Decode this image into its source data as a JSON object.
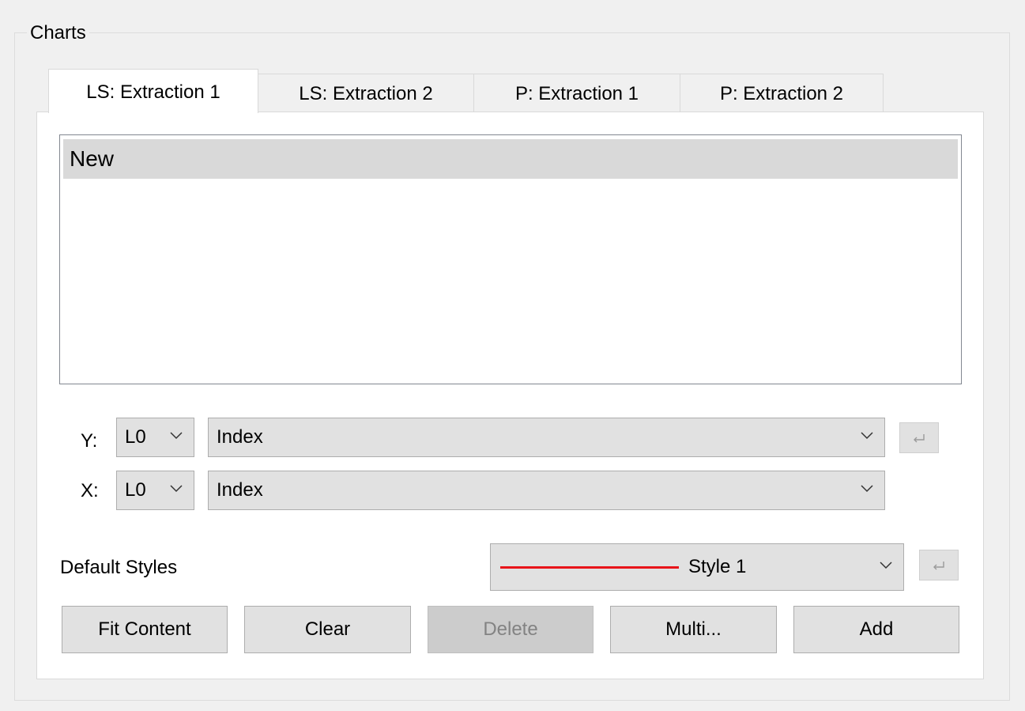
{
  "groupbox": {
    "title": "Charts"
  },
  "tabs": [
    {
      "label": "LS: Extraction 1",
      "active": true
    },
    {
      "label": "LS: Extraction 2",
      "active": false
    },
    {
      "label": "P: Extraction 1",
      "active": false
    },
    {
      "label": "P: Extraction 2",
      "active": false
    }
  ],
  "chart_list": {
    "items": [
      {
        "label": "New",
        "selected": true
      }
    ]
  },
  "y_axis": {
    "label": "Y:",
    "level": "L0",
    "field": "Index"
  },
  "x_axis": {
    "label": "X:",
    "level": "L0",
    "field": "Index"
  },
  "default_styles": {
    "label": "Default Styles",
    "selected_style": "Style 1",
    "line_color": "#e8141a"
  },
  "buttons": {
    "fit_content": "Fit Content",
    "clear": "Clear",
    "delete": "Delete",
    "multi": "Multi...",
    "add": "Add"
  },
  "icons": {
    "enter": "enter-return-icon",
    "dropdown": "chevron-down-icon"
  }
}
